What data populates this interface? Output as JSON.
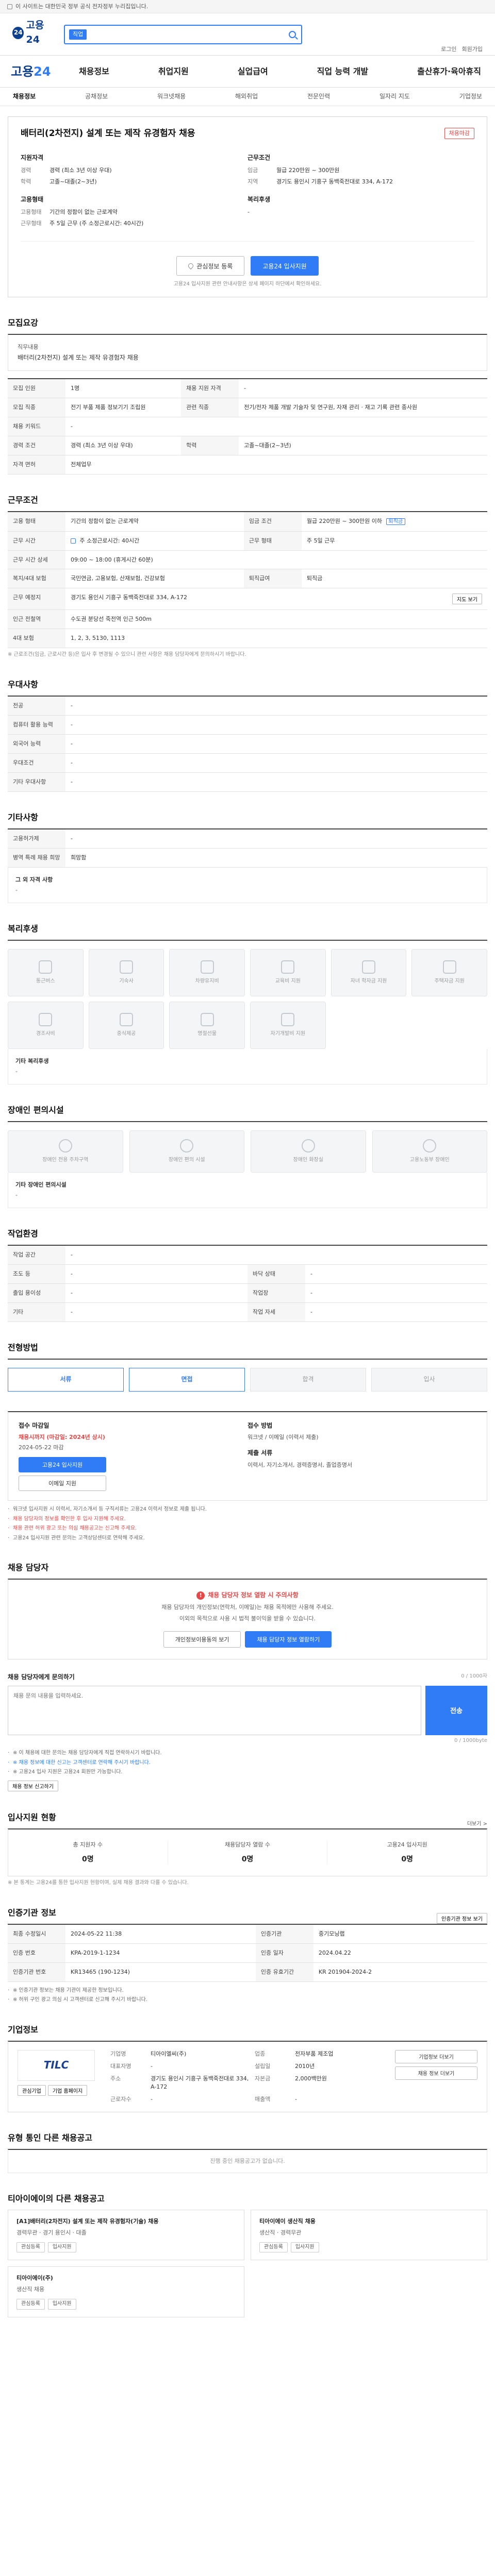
{
  "topbar": {
    "notice": "이 사이트는 대한민국 정부 공식 전자정부 누리집입니다."
  },
  "header": {
    "logo": "고용24",
    "search_badge": "직업",
    "search_placeholder": "",
    "links": [
      "로그인",
      "회원가입"
    ]
  },
  "gnb": {
    "brand_a": "고용",
    "brand_b": "24",
    "items": [
      "채용정보",
      "취업지원",
      "실업급여",
      "직업 능력 개발",
      "출산휴가·육아휴직"
    ]
  },
  "subtabs": [
    "채용정보",
    "공채정보",
    "워크넷채용",
    "해외취업",
    "전문인력",
    "일자리 지도",
    "기업정보"
  ],
  "job": {
    "title": "배터리(2차전지) 설계 또는 제작 유경험자 채용",
    "badge": "채용마감",
    "req_title": "지원자격",
    "req": [
      {
        "k": "경력",
        "v": "경력 (최소 3년 이상 우대)"
      },
      {
        "k": "학력",
        "v": "고졸~대졸(2~3년)"
      }
    ],
    "work_title": "근무조건",
    "work": [
      {
        "k": "임금",
        "v": "월급 220만원 ~ 300만원"
      },
      {
        "k": "지역",
        "v": "경기도 용인시 기흥구 동백죽전대로 334, A-172"
      }
    ],
    "emp_title": "고용형태",
    "emp": [
      {
        "k": "고용형태",
        "v": "기간의 정함이 없는 근로계약"
      },
      {
        "k": "근무형태",
        "v": "주 5일 근무 (주 소정근로시간: 40시간)"
      }
    ],
    "benefit_title": "복리후생",
    "benefit_value": "-",
    "btn_interest": "관심정보 등록",
    "btn_apply": "고용24 입사지원",
    "note": "고용24 입사지원 관련 안내사항은 상세 페이지 하단에서 확인하세요."
  },
  "recruit": {
    "title": "모집요강",
    "duty_label": "직무내용",
    "duty_value": "배터리(2차전지) 설계 또는 제작 유경험자 채용",
    "rows": [
      [
        "모집 인원",
        "1명",
        "채용 지원 자격",
        "-"
      ],
      [
        "모집 직종",
        "전기 부품 제품 정보기기 조립원",
        "관련 직종",
        "전기/전자 제품 개발 기술자 및 연구원, 자재 관리 · 재고 기록 관련 종사원"
      ],
      [
        "채용 키워드",
        "-",
        "",
        ""
      ],
      [
        "경력 조건",
        "경력 (최소 3년 이상 우대)",
        "학력",
        "고졸~대졸(2~3년)"
      ],
      [
        "자격 면허",
        "전체업무",
        "",
        ""
      ]
    ]
  },
  "work_cond": {
    "title": "근무조건",
    "rows": [
      [
        "고용 형태",
        "기간의 정함이 없는 근로계약",
        "임금 조건",
        "월급 220만원 ~ 300만원 이하"
      ],
      [
        "",
        "",
        "",
        "퇴직금"
      ],
      [
        "근무 시간",
        "주 소정근로시간: 40시간",
        "",
        ""
      ],
      [
        "근무 시간 상세",
        "09:00 ~ 18:00 (휴게시간 60분)",
        "",
        ""
      ],
      [
        "근무 예정지",
        "경기도 용인시 기흥구 동백죽전대로 334, A-172",
        "",
        ""
      ],
      [
        "인근 전철역",
        "수도권 분당선 죽전역 인근 500m",
        "",
        ""
      ],
      [
        "복지/4대 보험",
        "국민연금, 고용보험, 산재보험, 건강보험",
        "퇴직급여",
        "퇴직금"
      ]
    ],
    "shift": "주 5일 근무",
    "btn_map": "지도 보기",
    "insurance_label": "4대 보험",
    "insurance_value": "1, 2, 3, 5130, 1113",
    "note": "※ 근로조건(임금, 근로시간 등)은 입사 후 변경될 수 있으니 관련 사항은 채용 담당자에게 문의하시기 바랍니다."
  },
  "prefer": {
    "title": "우대사항",
    "rows": [
      [
        "전공",
        "-"
      ],
      [
        "컴퓨터 활용 능력",
        "-"
      ],
      [
        "외국어 능력",
        "-"
      ],
      [
        "우대조건",
        "-"
      ],
      [
        "기타 우대사항",
        "-"
      ]
    ]
  },
  "extra": {
    "title": "기타사항",
    "rows": [
      [
        "고용허가제",
        "-"
      ],
      [
        "병역 특례 채용 희망",
        "희망함"
      ]
    ],
    "other_label": "그 외 자격 사항",
    "other_value": "-"
  },
  "welfare": {
    "title": "복리후생",
    "items": [
      "통근버스",
      "기숙사",
      "차량유지비",
      "교육비 지원",
      "자녀 학자금 지원",
      "주택자금 지원",
      "경조사비",
      "중식제공",
      "명절선물",
      "자기개발비 지원",
      "",
      ""
    ],
    "other_label": "기타 복리후생",
    "other_value": "-"
  },
  "disabled": {
    "title": "장애인 편의시설",
    "items": [
      "장애인 전용 주차구역",
      "장애인 편의 시설",
      "장애인 화장실",
      "고용노동부 장애인"
    ],
    "other_label": "기타 장애인 편의시설",
    "other_value": "-"
  },
  "env": {
    "title": "작업환경",
    "rows": [
      [
        "작업 공간",
        "-",
        "",
        ""
      ],
      [
        "조도 등",
        "-",
        "바닥 상태",
        "-"
      ],
      [
        "출입 용이성",
        "-",
        "작업장",
        "-"
      ],
      [
        "기타",
        "-",
        "작업 자세",
        "-"
      ]
    ]
  },
  "process": {
    "title": "전형방법",
    "steps": [
      "서류",
      "면접",
      "합격",
      "입사"
    ]
  },
  "apply": {
    "title": "접수 마감일",
    "deadline": "채용시까지 (마감일: 2024년 상시)",
    "date_note": "2024-05-22 마감",
    "btn_apply": "고용24 입사지원",
    "btn_email": "이메일 지원",
    "method_title": "접수 방법",
    "method_value": "워크넷 / 이메일 (이력서 제출)",
    "docs_title": "제출 서류",
    "docs_value": "이력서, 자기소개서, 경력증명서, 졸업증명서",
    "notes": [
      "워크넷 입사지원 시 이력서, 자기소개서 등 구직서류는 고용24 이력서 정보로 제출 됩니다.",
      "채용 담당자의 정보를 확인한 후 입사 지원해 주세요.",
      "채용 관련 허위 광고 또는 의심 채용공고는 신고해 주세요.",
      "고용24 입사지원 관련 문의는 고객상담센터로 연락해 주세요."
    ]
  },
  "contact": {
    "title": "채용 담당자",
    "warn": "채용 담당자 정보 열람 시 주의사항",
    "p1": "채용 담당자의 개인정보(연락처, 이메일)는 채용 목적에만 사용해 주세요.",
    "p2": "이외의 목적으로 사용 시 법적 불이익을 받을 수 있습니다.",
    "btn1": "개인정보이용동의 보기",
    "btn2": "채용 담당자 정보 열람하기"
  },
  "inquiry": {
    "title": "채용 담당자에게 문의하기",
    "hint": "0 / 1000자",
    "placeholder": "채용 문의 내용을 입력하세요.",
    "send": "전송",
    "count": "0 / 1000byte",
    "notes": [
      "※ 이 채용에 대한 문의는 채용 담당자에게 직접 연락하시기 바랍니다.",
      "※ 채용 정보에 대한 신고는 고객센터로 연락해 주시기 바랍니다.",
      "※ 고용24 입사 지원은 고용24 회원만 가능합니다."
    ],
    "report_btn": "채용 정보 신고하기"
  },
  "stats": {
    "title": "입사지원 현황",
    "more": "더보기 >",
    "items": [
      {
        "l": "총 지원자 수",
        "n": "0명"
      },
      {
        "l": "채용담당자 열람 수",
        "n": "0명"
      },
      {
        "l": "고용24 입사지원",
        "n": "0명"
      }
    ],
    "note": "※ 본 통계는 고용24를 통한 입사지원 현황이며, 실제 채용 결과와 다를 수 있습니다."
  },
  "info": {
    "title": "인증기관 정보",
    "btn": "인증기관 정보 보기",
    "rows": [
      [
        "최종 수정일시",
        "2024-05-22 11:38",
        "인증기관",
        "중기모닝랩"
      ],
      [
        "인증 번호",
        "KPA-2019-1-1234",
        "인증 일자",
        "2024.04.22"
      ],
      [
        "인증기관 번호",
        "KR13465 (190-1234)",
        "인증 유효기간",
        "KR 201904-2024-2"
      ]
    ],
    "notes": [
      "※ 인증기관 정보는 채용 기관이 제공한 정보입니다.",
      "※ 허위 구인 광고 의심 시 고객센터로 신고해 주시기 바랍니다."
    ]
  },
  "company": {
    "title": "기업정보",
    "logo": "TILC",
    "btns": [
      "관심기업",
      "기업 홈페이지"
    ],
    "rows": [
      [
        "기업명",
        "티아이엘씨(주)",
        "업종",
        "전자부품 제조업"
      ],
      [
        "대표자명",
        "-",
        "설립일",
        "2010년"
      ],
      [
        "주소",
        "경기도 용인시 기흥구 동백죽전대로 334, A-172",
        "자본금",
        "2,000백만원"
      ],
      [
        "근로자수",
        "-",
        "매출액",
        "-"
      ]
    ],
    "right_btns": [
      "기업정보 더보기",
      "채용 정보 더보기"
    ]
  },
  "related": {
    "title": "유형 통인 다른 채용공고",
    "empty": "진행 중인 채용공고가 없습니다."
  },
  "others": {
    "title": "티아이에이의 다른 채용공고",
    "cards": [
      {
        "t": "[A1]배터리(2차전지) 설계 또는 제작 유경험자(기술) 채용",
        "meta": "경력무관 · 경기 용인시 · 대졸",
        "acts": [
          "관심등록",
          "입사지원"
        ]
      },
      {
        "t": "티아이에이 생산직 채용",
        "meta": "생산직 · 경력무관",
        "acts": [
          "관심등록",
          "입사지원"
        ]
      },
      {
        "t": "티아이에이(주)",
        "meta": "생산직 채용",
        "acts": [
          "관심등록",
          "입사지원"
        ]
      }
    ]
  }
}
